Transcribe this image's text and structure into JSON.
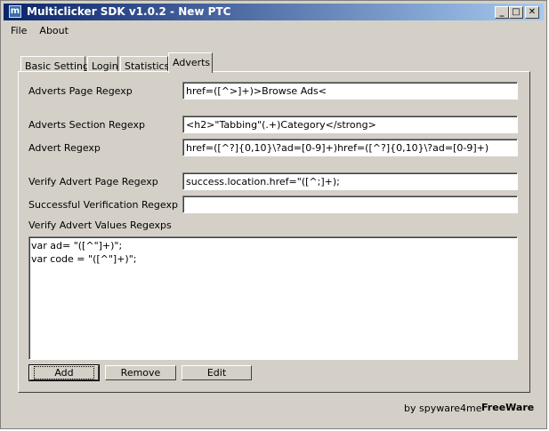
{
  "window": {
    "title": "Multiclicker SDK v1.0.2 - New PTC",
    "icon_glyph": "m",
    "controls": {
      "minimize": "_",
      "maximize": "□",
      "close": "✕"
    }
  },
  "menu": [
    "File",
    "About"
  ],
  "tabs": [
    {
      "label": "Basic Settings",
      "active": false
    },
    {
      "label": "Login",
      "active": false
    },
    {
      "label": "Statistics",
      "active": false
    },
    {
      "label": "Adverts",
      "active": true
    }
  ],
  "fields": {
    "adverts_page_regexp": {
      "label": "Adverts Page Regexp",
      "value": "href=([^>]+)>Browse Ads<"
    },
    "adverts_section_regexp": {
      "label": "Adverts Section Regexp",
      "value": "<h2>\"Tabbing\"(.+)Category</strong>"
    },
    "advert_regexp": {
      "label": "Advert Regexp",
      "value": "href=([^?]{0,10}\\?ad=[0-9]+)href=([^?]{0,10}\\?ad=[0-9]+)"
    },
    "verify_advert_page_regexp": {
      "label": "Verify Advert Page Regexp",
      "value": "success.location.href=\"([^;]+);"
    },
    "successful_verification_regexp": {
      "label": "Successful Verification Regexp",
      "value": ""
    }
  },
  "verify_values": {
    "label": "Verify Advert Values Regexps",
    "lines": [
      "var ad= \"([^\"]+)\";",
      "var code = \"([^\"]+)\";"
    ]
  },
  "buttons": {
    "add": "Add",
    "remove": "Remove",
    "edit": "Edit"
  },
  "footer": {
    "credit": "by spyware4me",
    "license": "FreeWare"
  },
  "colors": {
    "face": "#d4d0c8",
    "title_start": "#0a246a",
    "title_end": "#a6caf0"
  }
}
